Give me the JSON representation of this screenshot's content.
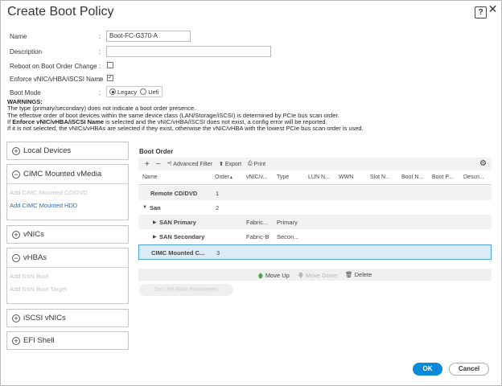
{
  "dialog": {
    "title": "Create Boot Policy",
    "help": "?",
    "close": "✕"
  },
  "form": {
    "name_label": "Name",
    "name_value": "Boot-FC-G370-A",
    "description_label": "Description",
    "description_value": "",
    "reboot_label": "Reboot on Boot Order Change",
    "reboot_checked": false,
    "enforce_label": "Enforce vNIC/vHBA/iSCSI Name",
    "enforce_checked": true,
    "boot_mode_label": "Boot Mode",
    "boot_mode_options": [
      "Legacy",
      "Uefi"
    ],
    "boot_mode_selected": "Legacy",
    "colon": ":"
  },
  "warnings": {
    "heading": "WARNINGS:",
    "line1": "The type (primary/secondary) does not indicate a boot order presence.",
    "line2": "The effective order of boot devices within the same device class (LAN/Storage/iSCSI) is determined by PCIe bus scan order.",
    "line3_pre": "If ",
    "line3_bold": "Enforce vNIC/vHBA/iSCSI Name",
    "line3_post": " is selected and the vNIC/vHBA/iSCSI does not exist, a config error will be reported.",
    "line4": "If it is not selected, the vNICs/vHBAs are selected if they exist, otherwise the vNIC/vHBA with the lowest PCIe bus scan order is used."
  },
  "left_panels": {
    "local_devices": {
      "label": "Local Devices",
      "toggle": "+"
    },
    "cimc_vmedia": {
      "label": "CIMC Mounted vMedia",
      "toggle": "−",
      "items": [
        "Add CIMC Mounted CD/DVD",
        "Add CIMC Mounted HDD"
      ]
    },
    "vnics": {
      "label": "vNICs",
      "toggle": "+"
    },
    "vhbas": {
      "label": "vHBAs",
      "toggle": "−",
      "items": [
        "Add SAN Boot",
        "Add SAN Boot Target"
      ]
    },
    "iscsi": {
      "label": "iSCSI vNICs",
      "toggle": "+"
    },
    "efi": {
      "label": "EFI Shell",
      "toggle": "+"
    }
  },
  "boot_order": {
    "title": "Boot Order",
    "toolbar": {
      "add": "+",
      "remove": "−",
      "filter": "Advanced Filter",
      "export": "Export",
      "print": "Print"
    },
    "columns": [
      "Name",
      "Order",
      "vNIC/v...",
      "Type",
      "LUN N...",
      "WWN",
      "Slot N...",
      "Boot N...",
      "Boot P...",
      "Descri..."
    ],
    "sort_arrow": "▲",
    "rows": [
      {
        "name": "Remote CD/DVD",
        "order": "1",
        "vnic": "",
        "type": ""
      },
      {
        "name": "San",
        "order": "2",
        "vnic": "",
        "type": ""
      },
      {
        "name": "SAN Primary",
        "order": "",
        "vnic": "Fabric...",
        "type": "Primary"
      },
      {
        "name": "SAN Secondary",
        "order": "",
        "vnic": "Fabric-B",
        "type": "Secon..."
      },
      {
        "name": "CIMC Mounted C...",
        "order": "3",
        "vnic": "",
        "type": ""
      }
    ],
    "move_up": "Move Up",
    "move_down": "Move Down",
    "delete": "Delete",
    "add_policy_button": "Set Uefi Boot Parameters"
  },
  "footer": {
    "ok": "OK",
    "cancel": "Cancel"
  },
  "colors": {
    "accent": "#0a8ad8",
    "link": "#2d6da8",
    "selected_row": "#dcebf7",
    "move_up_arrow": "#3aa83a"
  }
}
